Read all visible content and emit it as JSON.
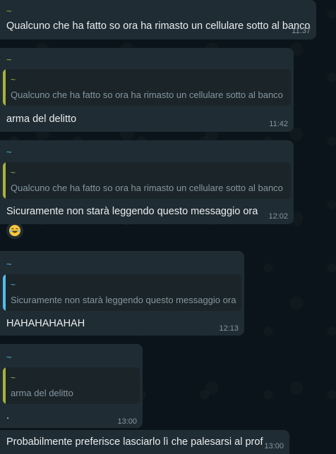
{
  "colors": {
    "background": "#0b141a",
    "bubble": "#202c33",
    "quote_bg": "#1a2429",
    "sender_yellow": "#a8b23a",
    "sender_blue": "#53bdeb",
    "timestamp": "#8696a0"
  },
  "messages": [
    {
      "sender": "~",
      "text": "Qualcuno che ha fatto so ora ha rimasto un cellulare sotto al banco",
      "time": "11:37"
    },
    {
      "sender": "~",
      "quote": {
        "sender": "~",
        "text": "Qualcuno che ha fatto so ora ha rimasto un cellulare sotto al banco"
      },
      "text": "arma del delitto",
      "time": "11:42"
    },
    {
      "sender": "~",
      "quote": {
        "sender": "~",
        "text": "Qualcuno che ha fatto so ora ha rimasto un cellulare sotto al banco"
      },
      "text": "Sicuramente non starà leggendo questo messaggio ora",
      "time": "12:02",
      "reaction": "laughing-emoji"
    },
    {
      "sender": "~",
      "quote": {
        "sender": "~",
        "text": "Sicuramente non starà leggendo questo messaggio ora"
      },
      "text": "HAHAHAHAHAH",
      "time": "12:13"
    },
    {
      "sender": "~",
      "quote": {
        "sender": "~",
        "text": "arma del delitto"
      },
      "text": ".",
      "time": "13:00"
    },
    {
      "text": "Probabilmente preferisce lasciarlo lì che palesarsi al prof",
      "time": "13:00"
    }
  ]
}
